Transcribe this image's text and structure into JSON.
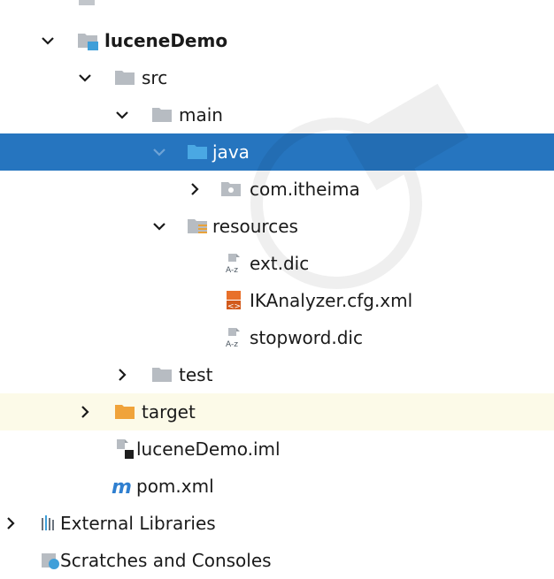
{
  "project_tree": {
    "nodes": [
      {
        "label": "luceneDemo",
        "icon": "module-folder-icon",
        "arrow": "expanded",
        "bold": true
      },
      {
        "label": "src",
        "icon": "folder-icon",
        "arrow": "expanded"
      },
      {
        "label": "main",
        "icon": "folder-icon",
        "arrow": "expanded"
      },
      {
        "label": "java",
        "icon": "source-folder-icon",
        "arrow": "expanded",
        "selected": true
      },
      {
        "label": "com.itheima",
        "icon": "package-icon",
        "arrow": "collapsed"
      },
      {
        "label": "resources",
        "icon": "resources-folder-icon",
        "arrow": "expanded"
      },
      {
        "label": "ext.dic",
        "icon": "text-file-icon"
      },
      {
        "label": "IKAnalyzer.cfg.xml",
        "icon": "xml-file-icon"
      },
      {
        "label": "stopword.dic",
        "icon": "text-file-icon"
      },
      {
        "label": "test",
        "icon": "folder-icon",
        "arrow": "collapsed"
      },
      {
        "label": "target",
        "icon": "excluded-folder-icon",
        "arrow": "collapsed",
        "excluded": true
      },
      {
        "label": "luceneDemo.iml",
        "icon": "iml-file-icon"
      },
      {
        "label": "pom.xml",
        "icon": "maven-icon"
      },
      {
        "label": "External Libraries",
        "icon": "libraries-icon",
        "arrow": "collapsed"
      },
      {
        "label": "Scratches and Consoles",
        "icon": "scratches-icon"
      }
    ]
  },
  "colors": {
    "selection": "#2675bf",
    "excluded_row": "#fcfae8",
    "folder": "#b7bcc2",
    "source_folder": "#3f9fd9",
    "excluded_folder": "#f0a33a",
    "xml_icon": "#e8702a"
  }
}
